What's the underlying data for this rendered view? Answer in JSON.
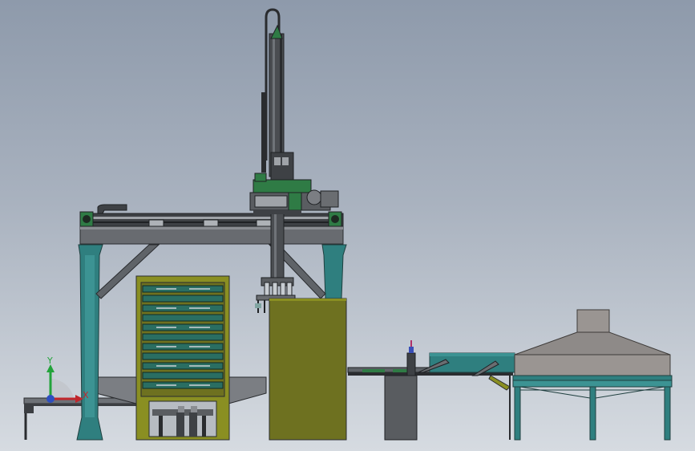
{
  "viewport": {
    "background_top": "#8e9aab",
    "background_bottom": "#d6dbe1"
  },
  "triad": {
    "y_label": "Y",
    "x_label": "X",
    "y_color": "#22a33a",
    "x_color": "#c0262c",
    "z_color": "#2e4fc0"
  },
  "colors": {
    "frame_teal": "#2f7f7f",
    "beam_gray": "#6b6e72",
    "olive": "#8a8f22",
    "olive_dark": "#6e7120",
    "slat_teal": "#2a6e62",
    "robot_green": "#2f7b45",
    "hood_gray": "#8e8a88"
  },
  "icons": {
    "triad": "coordinate-triad-icon",
    "rotate": "rotate-view-icon"
  }
}
